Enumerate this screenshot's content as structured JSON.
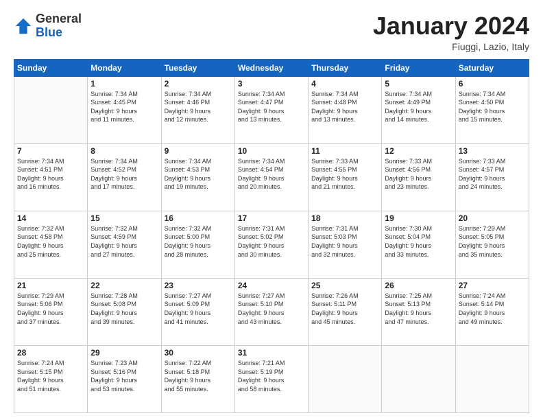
{
  "header": {
    "logo_general": "General",
    "logo_blue": "Blue",
    "month_title": "January 2024",
    "location": "Fiuggi, Lazio, Italy"
  },
  "weekdays": [
    "Sunday",
    "Monday",
    "Tuesday",
    "Wednesday",
    "Thursday",
    "Friday",
    "Saturday"
  ],
  "weeks": [
    [
      {
        "day": "",
        "info": ""
      },
      {
        "day": "1",
        "info": "Sunrise: 7:34 AM\nSunset: 4:45 PM\nDaylight: 9 hours\nand 11 minutes."
      },
      {
        "day": "2",
        "info": "Sunrise: 7:34 AM\nSunset: 4:46 PM\nDaylight: 9 hours\nand 12 minutes."
      },
      {
        "day": "3",
        "info": "Sunrise: 7:34 AM\nSunset: 4:47 PM\nDaylight: 9 hours\nand 13 minutes."
      },
      {
        "day": "4",
        "info": "Sunrise: 7:34 AM\nSunset: 4:48 PM\nDaylight: 9 hours\nand 13 minutes."
      },
      {
        "day": "5",
        "info": "Sunrise: 7:34 AM\nSunset: 4:49 PM\nDaylight: 9 hours\nand 14 minutes."
      },
      {
        "day": "6",
        "info": "Sunrise: 7:34 AM\nSunset: 4:50 PM\nDaylight: 9 hours\nand 15 minutes."
      }
    ],
    [
      {
        "day": "7",
        "info": "Sunrise: 7:34 AM\nSunset: 4:51 PM\nDaylight: 9 hours\nand 16 minutes."
      },
      {
        "day": "8",
        "info": "Sunrise: 7:34 AM\nSunset: 4:52 PM\nDaylight: 9 hours\nand 17 minutes."
      },
      {
        "day": "9",
        "info": "Sunrise: 7:34 AM\nSunset: 4:53 PM\nDaylight: 9 hours\nand 19 minutes."
      },
      {
        "day": "10",
        "info": "Sunrise: 7:34 AM\nSunset: 4:54 PM\nDaylight: 9 hours\nand 20 minutes."
      },
      {
        "day": "11",
        "info": "Sunrise: 7:33 AM\nSunset: 4:55 PM\nDaylight: 9 hours\nand 21 minutes."
      },
      {
        "day": "12",
        "info": "Sunrise: 7:33 AM\nSunset: 4:56 PM\nDaylight: 9 hours\nand 23 minutes."
      },
      {
        "day": "13",
        "info": "Sunrise: 7:33 AM\nSunset: 4:57 PM\nDaylight: 9 hours\nand 24 minutes."
      }
    ],
    [
      {
        "day": "14",
        "info": "Sunrise: 7:32 AM\nSunset: 4:58 PM\nDaylight: 9 hours\nand 25 minutes."
      },
      {
        "day": "15",
        "info": "Sunrise: 7:32 AM\nSunset: 4:59 PM\nDaylight: 9 hours\nand 27 minutes."
      },
      {
        "day": "16",
        "info": "Sunrise: 7:32 AM\nSunset: 5:00 PM\nDaylight: 9 hours\nand 28 minutes."
      },
      {
        "day": "17",
        "info": "Sunrise: 7:31 AM\nSunset: 5:02 PM\nDaylight: 9 hours\nand 30 minutes."
      },
      {
        "day": "18",
        "info": "Sunrise: 7:31 AM\nSunset: 5:03 PM\nDaylight: 9 hours\nand 32 minutes."
      },
      {
        "day": "19",
        "info": "Sunrise: 7:30 AM\nSunset: 5:04 PM\nDaylight: 9 hours\nand 33 minutes."
      },
      {
        "day": "20",
        "info": "Sunrise: 7:29 AM\nSunset: 5:05 PM\nDaylight: 9 hours\nand 35 minutes."
      }
    ],
    [
      {
        "day": "21",
        "info": "Sunrise: 7:29 AM\nSunset: 5:06 PM\nDaylight: 9 hours\nand 37 minutes."
      },
      {
        "day": "22",
        "info": "Sunrise: 7:28 AM\nSunset: 5:08 PM\nDaylight: 9 hours\nand 39 minutes."
      },
      {
        "day": "23",
        "info": "Sunrise: 7:27 AM\nSunset: 5:09 PM\nDaylight: 9 hours\nand 41 minutes."
      },
      {
        "day": "24",
        "info": "Sunrise: 7:27 AM\nSunset: 5:10 PM\nDaylight: 9 hours\nand 43 minutes."
      },
      {
        "day": "25",
        "info": "Sunrise: 7:26 AM\nSunset: 5:11 PM\nDaylight: 9 hours\nand 45 minutes."
      },
      {
        "day": "26",
        "info": "Sunrise: 7:25 AM\nSunset: 5:13 PM\nDaylight: 9 hours\nand 47 minutes."
      },
      {
        "day": "27",
        "info": "Sunrise: 7:24 AM\nSunset: 5:14 PM\nDaylight: 9 hours\nand 49 minutes."
      }
    ],
    [
      {
        "day": "28",
        "info": "Sunrise: 7:24 AM\nSunset: 5:15 PM\nDaylight: 9 hours\nand 51 minutes."
      },
      {
        "day": "29",
        "info": "Sunrise: 7:23 AM\nSunset: 5:16 PM\nDaylight: 9 hours\nand 53 minutes."
      },
      {
        "day": "30",
        "info": "Sunrise: 7:22 AM\nSunset: 5:18 PM\nDaylight: 9 hours\nand 55 minutes."
      },
      {
        "day": "31",
        "info": "Sunrise: 7:21 AM\nSunset: 5:19 PM\nDaylight: 9 hours\nand 58 minutes."
      },
      {
        "day": "",
        "info": ""
      },
      {
        "day": "",
        "info": ""
      },
      {
        "day": "",
        "info": ""
      }
    ]
  ]
}
